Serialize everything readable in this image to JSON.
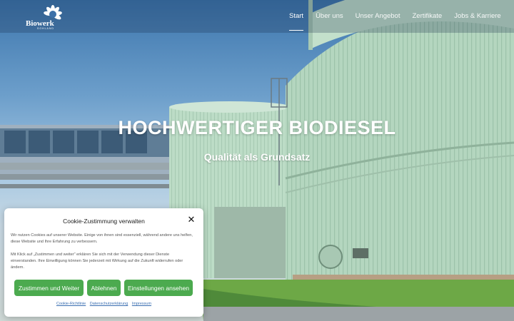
{
  "brand": {
    "name": "Biowerk",
    "tagline": "SOHLAND"
  },
  "nav": {
    "items": [
      {
        "label": "Start",
        "active": true
      },
      {
        "label": "Über uns"
      },
      {
        "label": "Unser Angebot"
      },
      {
        "label": "Zertifikate"
      },
      {
        "label": "Jobs & Karriere"
      }
    ]
  },
  "hero": {
    "title": "HOCHWERTIGER BIODIESEL",
    "subtitle": "Qualität als Grundsatz"
  },
  "cookie": {
    "title": "Cookie-Zustimmung verwalten",
    "paragraph1": "Wir nutzen Cookies auf unserer Website. Einige von ihnen sind essenziell, während andere uns helfen, diese Website und Ihre Erfahrung zu verbessern.",
    "paragraph2": "Mit Klick auf „Zustimmen und weiter\" erklären Sie sich mit der Verwendung dieser Dienste einverstanden. Ihre Einwilligung können Sie jederzeit mit Wirkung auf die Zukunft widerrufen oder ändern.",
    "accept_label": "Zustimmen und Weiter",
    "deny_label": "Ablehnen",
    "settings_label": "Einstellungen ansehen",
    "links": [
      "Cookie-Richtlinie",
      "Datenschutzerklärung",
      "Impressum"
    ]
  },
  "colors": {
    "accent": "#4caa4f",
    "link": "#3b6fb1",
    "tank": "#b7d9c3"
  }
}
